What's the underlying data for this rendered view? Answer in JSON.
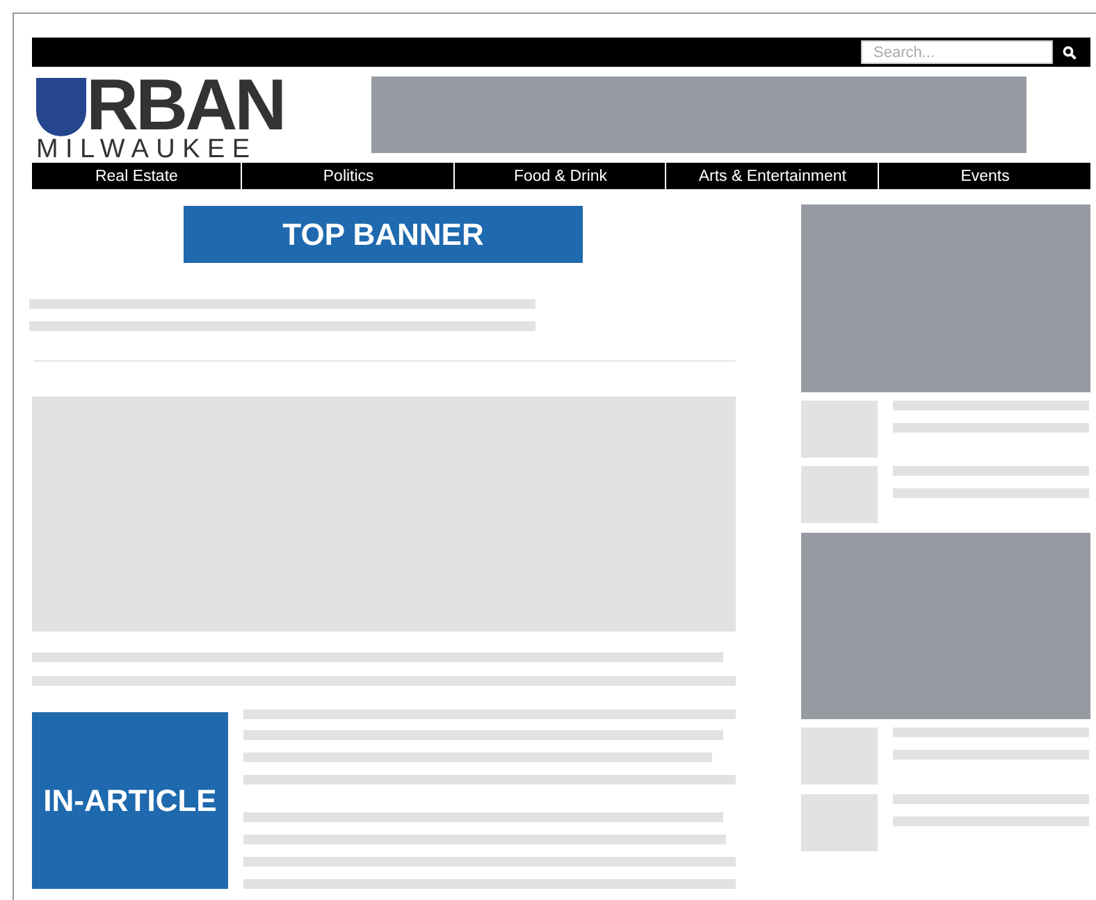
{
  "search": {
    "placeholder": "Search..."
  },
  "logo": {
    "word": "RBAN",
    "subtitle": "MILWAUKEE"
  },
  "nav": [
    {
      "label": "Real Estate"
    },
    {
      "label": "Politics"
    },
    {
      "label": "Food & Drink"
    },
    {
      "label": "Arts & Entertainment"
    },
    {
      "label": "Events"
    }
  ],
  "top_banner": "TOP BANNER",
  "in_article": "IN-ARTICLE"
}
